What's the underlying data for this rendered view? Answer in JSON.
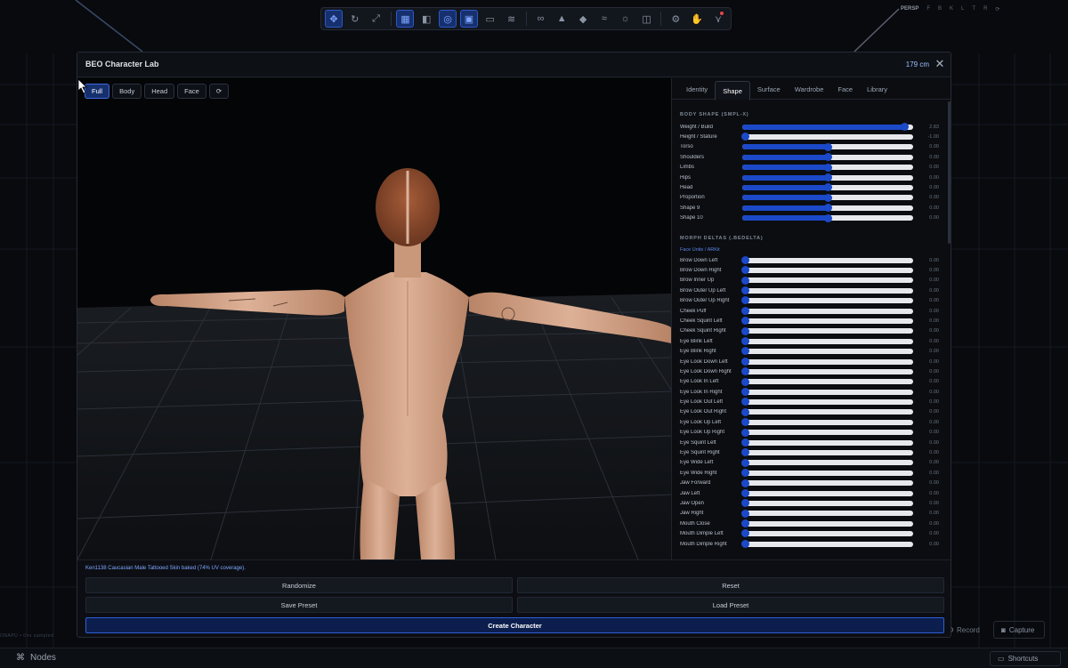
{
  "toolbar": {
    "buttons": [
      {
        "icon": "move-icon",
        "active": true
      },
      {
        "icon": "rotate-icon",
        "active": false
      },
      {
        "icon": "scale-icon",
        "active": false
      },
      {
        "icon": "grid-icon",
        "active": true
      },
      {
        "icon": "layout-icon",
        "active": false
      },
      {
        "icon": "globe-icon",
        "active": true
      },
      {
        "icon": "frame-icon",
        "active": true
      },
      {
        "icon": "camera-icon",
        "active": false
      },
      {
        "icon": "layers-icon",
        "active": false
      },
      {
        "icon": "link-icon",
        "active": false
      },
      {
        "icon": "cone-icon",
        "active": false
      },
      {
        "icon": "drop-icon",
        "active": false
      },
      {
        "icon": "wind-icon",
        "active": false
      },
      {
        "icon": "sun-icon",
        "active": false
      },
      {
        "icon": "map-icon",
        "active": false
      },
      {
        "icon": "gear-icon",
        "active": false
      },
      {
        "icon": "hand-icon",
        "active": false
      },
      {
        "icon": "graph-icon",
        "active": false
      }
    ]
  },
  "viewport_axes": [
    "PERSP",
    "F",
    "B",
    "K",
    "L",
    "T",
    "R",
    "⟳"
  ],
  "bottom": {
    "nodes_label": "Nodes",
    "shortcuts_label": "Shortcuts",
    "record_label": "Record",
    "capture_label": "Capture",
    "stats": "ONAPU • 0ns sampled"
  },
  "modal": {
    "title": "BEO Character Lab",
    "height_readout": "179 cm",
    "view_buttons": [
      "Full",
      "Body",
      "Head",
      "Face",
      "⟳"
    ],
    "active_view": "Full",
    "tabs": [
      "Identity",
      "Shape",
      "Surface",
      "Wardrobe",
      "Face",
      "Library"
    ],
    "active_tab": "Shape",
    "section_body": "BODY SHAPE (SMPL-X)",
    "body_sliders": [
      {
        "label": "Weight / Build",
        "value": "2.83",
        "level": 0.95
      },
      {
        "label": "Height / Stature",
        "value": "-1.00",
        "level": 0.02
      },
      {
        "label": "Torso",
        "value": "0.00",
        "level": 0.5
      },
      {
        "label": "Shoulders",
        "value": "0.00",
        "level": 0.5
      },
      {
        "label": "Limbs",
        "value": "0.00",
        "level": 0.5
      },
      {
        "label": "Hips",
        "value": "0.00",
        "level": 0.5
      },
      {
        "label": "Head",
        "value": "0.00",
        "level": 0.5
      },
      {
        "label": "Proportion",
        "value": "0.00",
        "level": 0.5
      },
      {
        "label": "Shape 9",
        "value": "0.00",
        "level": 0.5
      },
      {
        "label": "Shape 10",
        "value": "0.00",
        "level": 0.5
      }
    ],
    "section_morph": "MORPH DELTAS (.BEDELTA)",
    "morph_group": "Face Units / ARKit",
    "morph_sliders": [
      {
        "label": "Brow Down Left",
        "value": "0.00",
        "level": 0.02
      },
      {
        "label": "Brow Down Right",
        "value": "0.00",
        "level": 0.02
      },
      {
        "label": "Brow Inner Up",
        "value": "0.00",
        "level": 0.02
      },
      {
        "label": "Brow Outer Up Left",
        "value": "0.00",
        "level": 0.02
      },
      {
        "label": "Brow Outer Up Right",
        "value": "0.00",
        "level": 0.02
      },
      {
        "label": "Cheek Puff",
        "value": "0.00",
        "level": 0.02
      },
      {
        "label": "Cheek Squint Left",
        "value": "0.00",
        "level": 0.02
      },
      {
        "label": "Cheek Squint Right",
        "value": "0.00",
        "level": 0.02
      },
      {
        "label": "Eye Blink Left",
        "value": "0.00",
        "level": 0.02
      },
      {
        "label": "Eye Blink Right",
        "value": "0.00",
        "level": 0.02
      },
      {
        "label": "Eye Look Down Left",
        "value": "0.00",
        "level": 0.02
      },
      {
        "label": "Eye Look Down Right",
        "value": "0.00",
        "level": 0.02
      },
      {
        "label": "Eye Look In Left",
        "value": "0.00",
        "level": 0.02
      },
      {
        "label": "Eye Look In Right",
        "value": "0.00",
        "level": 0.02
      },
      {
        "label": "Eye Look Out Left",
        "value": "0.00",
        "level": 0.02
      },
      {
        "label": "Eye Look Out Right",
        "value": "0.00",
        "level": 0.02
      },
      {
        "label": "Eye Look Up Left",
        "value": "0.00",
        "level": 0.02
      },
      {
        "label": "Eye Look Up Right",
        "value": "0.00",
        "level": 0.02
      },
      {
        "label": "Eye Squint Left",
        "value": "0.00",
        "level": 0.02
      },
      {
        "label": "Eye Squint Right",
        "value": "0.00",
        "level": 0.02
      },
      {
        "label": "Eye Wide Left",
        "value": "0.00",
        "level": 0.02
      },
      {
        "label": "Eye Wide Right",
        "value": "0.00",
        "level": 0.02
      },
      {
        "label": "Jaw Forward",
        "value": "0.00",
        "level": 0.02
      },
      {
        "label": "Jaw Left",
        "value": "0.00",
        "level": 0.02
      },
      {
        "label": "Jaw Open",
        "value": "0.00",
        "level": 0.02
      },
      {
        "label": "Jaw Right",
        "value": "0.00",
        "level": 0.02
      },
      {
        "label": "Mouth Close",
        "value": "0.00",
        "level": 0.02
      },
      {
        "label": "Mouth Dimple Left",
        "value": "0.00",
        "level": 0.02
      },
      {
        "label": "Mouth Dimple Right",
        "value": "0.00",
        "level": 0.02
      }
    ],
    "status_text": "Ken1138 Caucasian Male Tattooed Skin baked (74% UV coverage).",
    "buttons": {
      "randomize": "Randomize",
      "reset": "Reset",
      "save_preset": "Save Preset",
      "load_preset": "Load Preset",
      "create": "Create Character"
    }
  },
  "colors": {
    "accent": "#1b49c8",
    "accent_light": "#7ea6ff",
    "skin": "#d8a98a",
    "hair": "#8a4a2c"
  }
}
